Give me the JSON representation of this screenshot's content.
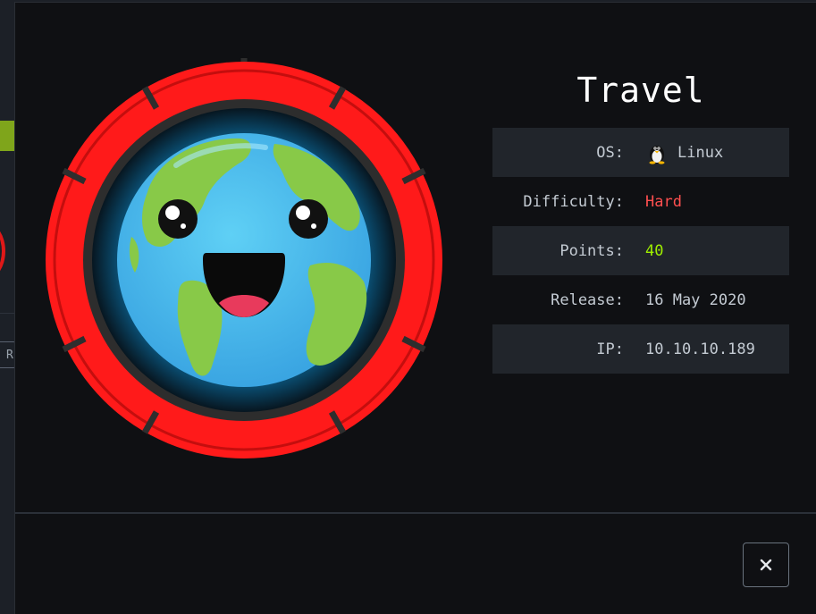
{
  "machine": {
    "name": "Travel"
  },
  "info": [
    {
      "label": "OS:",
      "value": "Linux",
      "icon": "tux-penguin-icon",
      "color": "#c4cbd3"
    },
    {
      "label": "Difficulty:",
      "value": "Hard",
      "color": "#ff4f4f"
    },
    {
      "label": "Points:",
      "value": "40",
      "color": "#9fef00"
    },
    {
      "label": "Release:",
      "value": "16 May 2020",
      "color": "#c4cbd3"
    },
    {
      "label": "IP:",
      "value": "10.10.10.189",
      "color": "#c4cbd3"
    }
  ],
  "close_button": {
    "icon": "close-icon",
    "glyph": "✕"
  },
  "background": {
    "button_fragment": "R"
  },
  "colors": {
    "ring": "#ff1a1a",
    "accent_green": "#9fef00",
    "difficulty_hard": "#ff4f4f",
    "modal_bg": "#0f1013"
  }
}
